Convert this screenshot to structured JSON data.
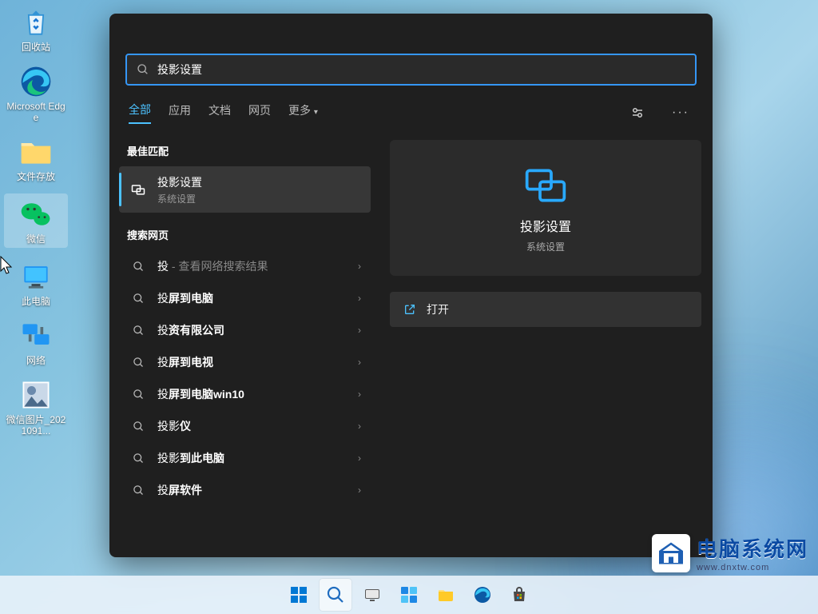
{
  "desktop": {
    "icons": [
      {
        "id": "recycle-bin",
        "label": "回收站"
      },
      {
        "id": "edge",
        "label": "Microsoft Edge"
      },
      {
        "id": "folder-files",
        "label": "文件存放"
      },
      {
        "id": "wechat",
        "label": "微信"
      },
      {
        "id": "this-pc",
        "label": "此电脑"
      },
      {
        "id": "network",
        "label": "网络"
      },
      {
        "id": "image-file",
        "label": "微信图片_2021091..."
      }
    ]
  },
  "search": {
    "query": "投影设置",
    "tabs": {
      "all": "全部",
      "apps": "应用",
      "docs": "文档",
      "web": "网页",
      "more": "更多"
    },
    "sections": {
      "best_match": "最佳匹配",
      "search_web": "搜索网页"
    },
    "best_match": {
      "title": "投影设置",
      "subtitle": "系统设置"
    },
    "web_results": [
      {
        "prefix": "投",
        "suffix": " - 查看网络搜索结果"
      },
      {
        "prefix": "投",
        "bold": "屏到电脑",
        "suffix": ""
      },
      {
        "prefix": "投",
        "bold": "资有限公司",
        "suffix": ""
      },
      {
        "prefix": "投",
        "bold": "屏到电视",
        "suffix": ""
      },
      {
        "prefix": "投",
        "bold": "屏到电脑win10",
        "suffix": ""
      },
      {
        "prefix": "投影",
        "bold": "仪",
        "suffix": ""
      },
      {
        "prefix": "投影",
        "bold": "到此电脑",
        "suffix": ""
      },
      {
        "prefix": "投",
        "bold": "屏软件",
        "suffix": ""
      }
    ],
    "preview": {
      "title": "投影设置",
      "subtitle": "系统设置",
      "open_label": "打开"
    }
  },
  "watermark": {
    "title": "电脑系统网",
    "url": "www.dnxtw.com"
  }
}
